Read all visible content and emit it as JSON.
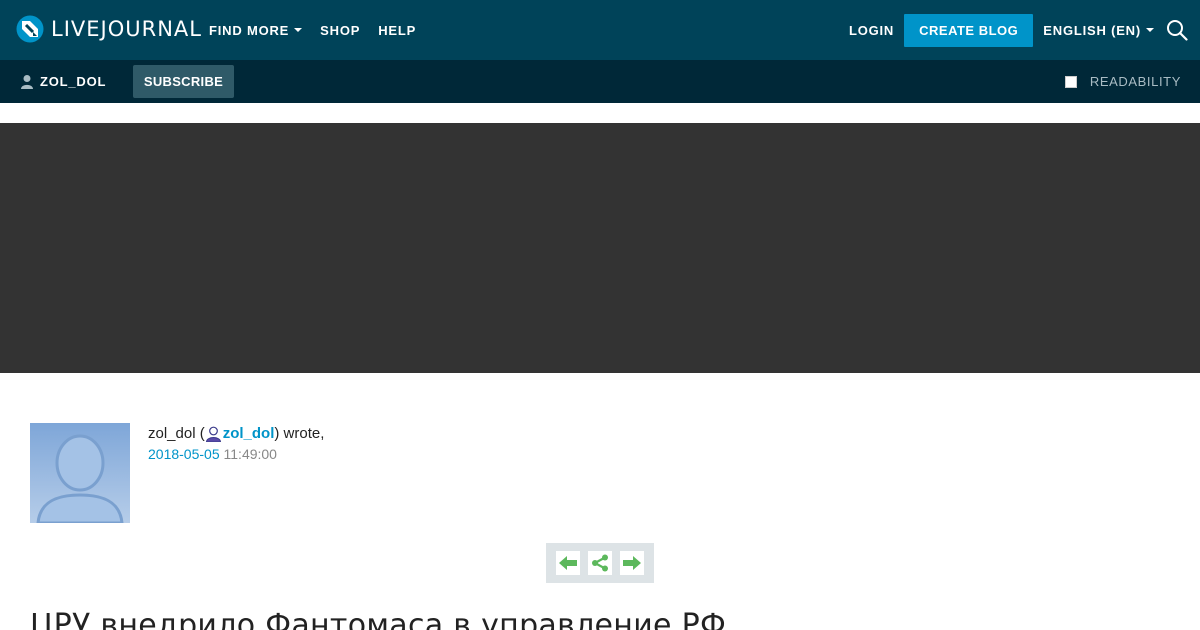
{
  "header": {
    "brand": "LIVEJOURNAL",
    "nav": [
      {
        "label": "FIND MORE",
        "dropdown": true
      },
      {
        "label": "SHOP",
        "dropdown": false
      },
      {
        "label": "HELP",
        "dropdown": false
      }
    ],
    "login_label": "LOGIN",
    "create_blog_label": "CREATE BLOG",
    "language_label": "ENGLISH (EN)"
  },
  "subbar": {
    "username": "ZOL_DOL",
    "subscribe_label": "SUBSCRIBE",
    "readability_label": "READABILITY"
  },
  "entry": {
    "author_name": "zol_dol (",
    "author_user": "zol_dol",
    "wrote_suffix": ") wrote,",
    "date": "2018-05-05",
    "time": "11:49:00",
    "title": "ЦРУ внедрило Фантомаса в управление РФ"
  },
  "colors": {
    "topbar": "#004359",
    "subbar": "#002838",
    "accent": "#0094c9",
    "banner": "#333333",
    "nav_arrows": "#5cb85c"
  },
  "icons": [
    "logo-mark-icon",
    "caret-down-icon",
    "search-icon",
    "user-icon",
    "checkbox-icon",
    "avatar-silhouette-icon",
    "arrow-left-icon",
    "share-icon",
    "arrow-right-icon"
  ]
}
